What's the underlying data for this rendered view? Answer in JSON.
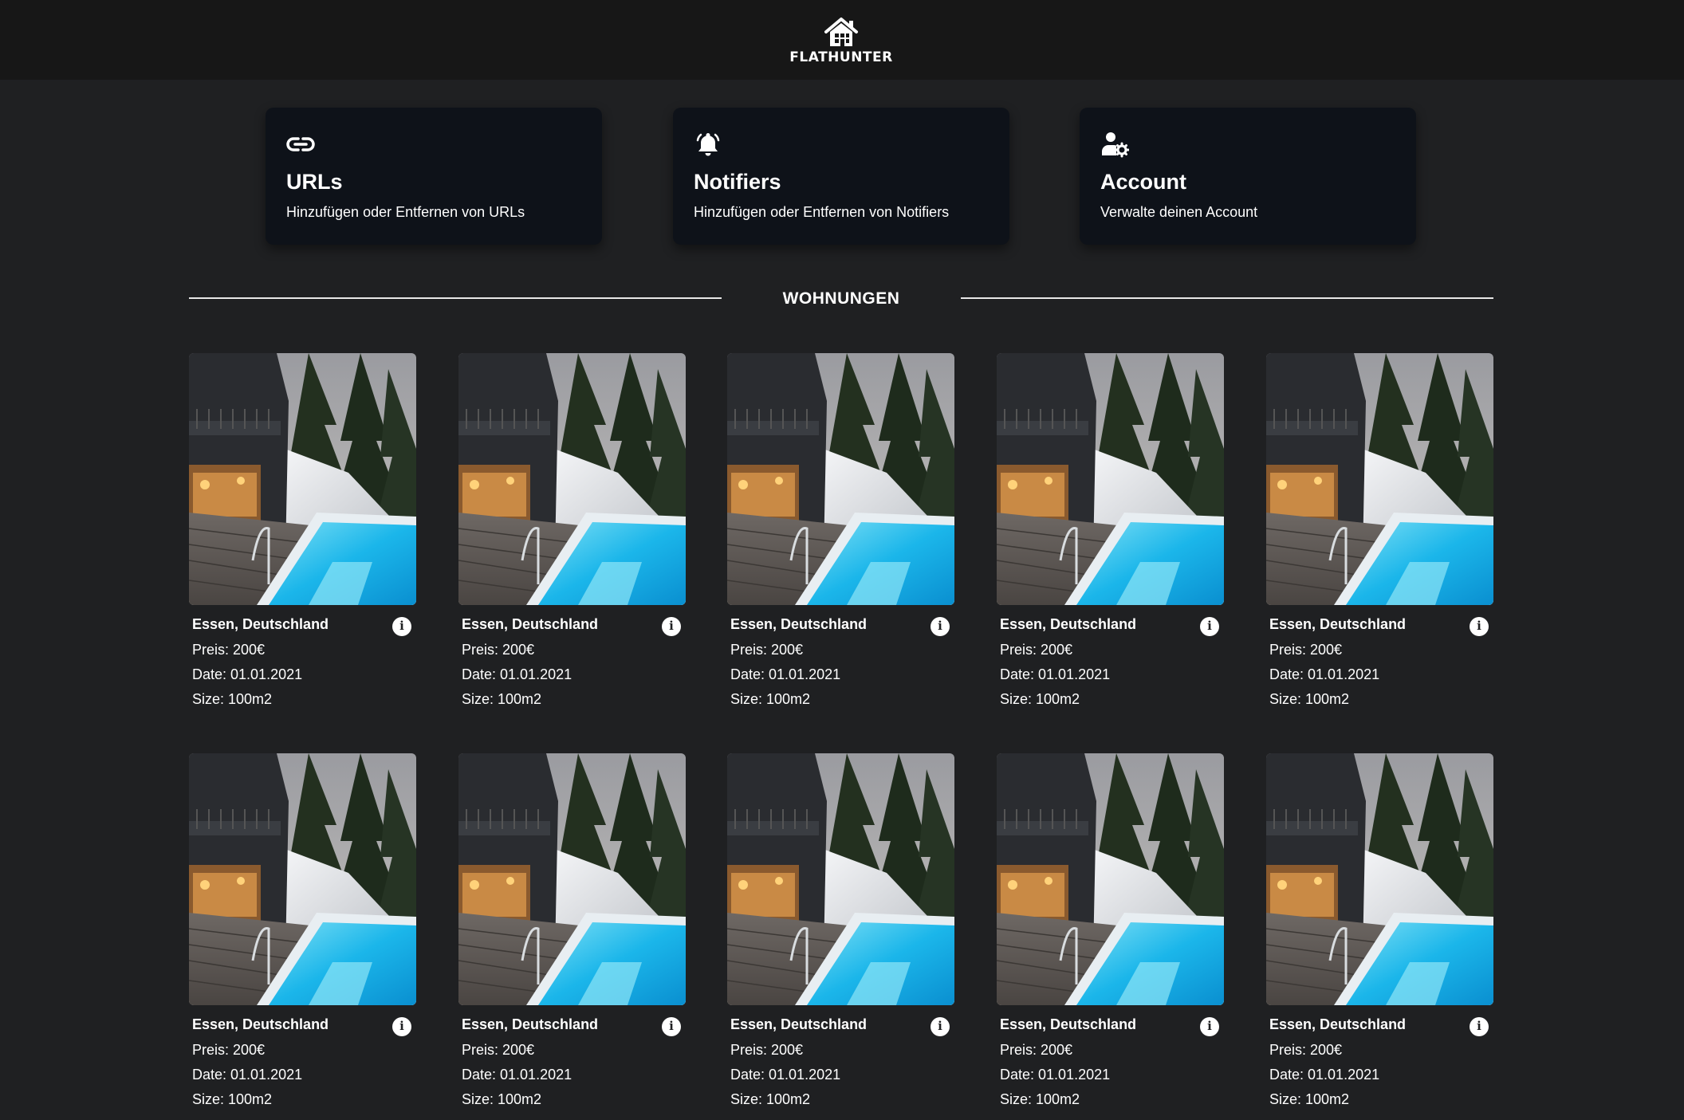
{
  "header": {
    "logo_text": "FLATHUNTER"
  },
  "cards": [
    {
      "title": "URLs",
      "description": "Hinzufügen oder Entfernen von URLs",
      "icon": "link-icon"
    },
    {
      "title": "Notifiers",
      "description": "Hinzufügen oder Entfernen von Notifiers",
      "icon": "bell-icon"
    },
    {
      "title": "Account",
      "description": "Verwalte deinen Account",
      "icon": "user-gear-icon"
    }
  ],
  "section": {
    "title": "WOHNUNGEN"
  },
  "flats": [
    {
      "location": "Essen, Deutschland",
      "price": "Preis: 200€",
      "date": "Date: 01.01.2021",
      "size": "Size: 100m2"
    },
    {
      "location": "Essen, Deutschland",
      "price": "Preis: 200€",
      "date": "Date: 01.01.2021",
      "size": "Size: 100m2"
    },
    {
      "location": "Essen, Deutschland",
      "price": "Preis: 200€",
      "date": "Date: 01.01.2021",
      "size": "Size: 100m2"
    },
    {
      "location": "Essen, Deutschland",
      "price": "Preis: 200€",
      "date": "Date: 01.01.2021",
      "size": "Size: 100m2"
    },
    {
      "location": "Essen, Deutschland",
      "price": "Preis: 200€",
      "date": "Date: 01.01.2021",
      "size": "Size: 100m2"
    },
    {
      "location": "Essen, Deutschland",
      "price": "Preis: 200€",
      "date": "Date: 01.01.2021",
      "size": "Size: 100m2"
    },
    {
      "location": "Essen, Deutschland",
      "price": "Preis: 200€",
      "date": "Date: 01.01.2021",
      "size": "Size: 100m2"
    },
    {
      "location": "Essen, Deutschland",
      "price": "Preis: 200€",
      "date": "Date: 01.01.2021",
      "size": "Size: 100m2"
    },
    {
      "location": "Essen, Deutschland",
      "price": "Preis: 200€",
      "date": "Date: 01.01.2021",
      "size": "Size: 100m2"
    },
    {
      "location": "Essen, Deutschland",
      "price": "Preis: 200€",
      "date": "Date: 01.01.2021",
      "size": "Size: 100m2"
    }
  ],
  "colors": {
    "background": "#1f2022",
    "header": "#171717",
    "card": "#0e1219",
    "text": "#ffffff"
  }
}
